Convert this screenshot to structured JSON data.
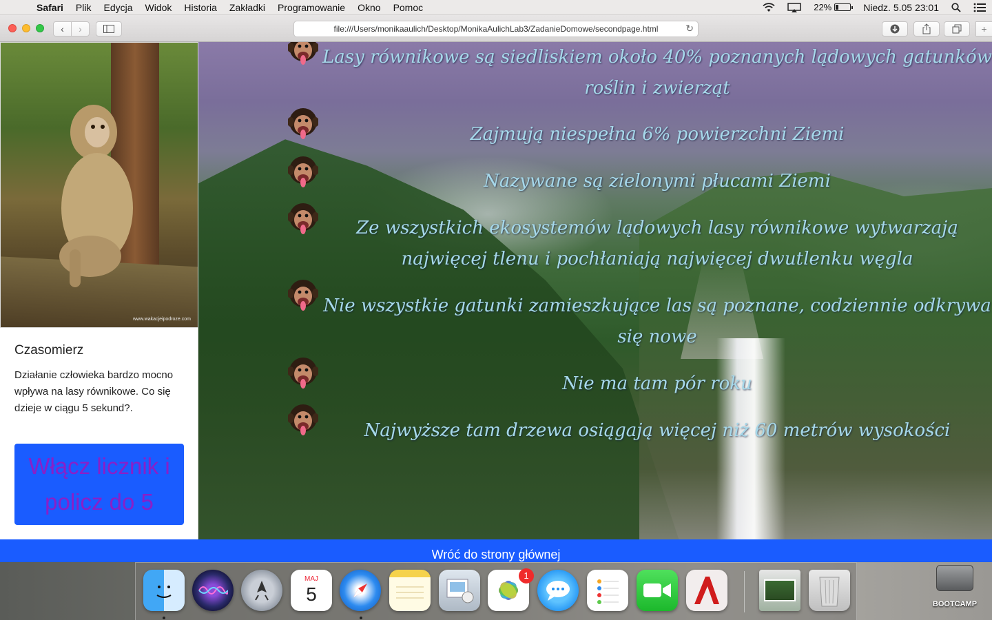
{
  "menubar": {
    "app_name": "Safari",
    "items": [
      "Plik",
      "Edycja",
      "Widok",
      "Historia",
      "Zakładki",
      "Programowanie",
      "Okno",
      "Pomoc"
    ],
    "battery_percent": "22%",
    "battery_level": 0.22,
    "datetime": "Niedz. 5.05  23:01"
  },
  "browser": {
    "url": "file:///Users/monikaaulich/Desktop/MonikaAulichLab3/ZadanieDomowe/secondpage.html"
  },
  "sidebar": {
    "photo_credit": "www.wakacjeipodroze.com",
    "timer": {
      "title": "Czasomierz",
      "description": "Działanie człowieka bardzo mocno wpływa na lasy równikowe. Co się dzieje w ciągu 5 sekund?.",
      "button_label": "Włącz licznik i policz do 5"
    }
  },
  "facts": [
    "Lasy równikowe są siedliskiem około 40% poznanych lądowych gatunków roślin i zwierząt",
    "Zajmują niespełna 6% powierzchni Ziemi",
    "Nazywane są zielonymi płucami Ziemi",
    "Ze wszystkich ekosystemów lądowych lasy równikowe wytwarzają najwięcej tlenu i pochłaniają najwięcej dwutlenku węgla",
    "Nie wszystkie gatunki zamieszkujące las są poznane, codziennie odkrywa się nowe",
    "Nie ma tam pór roku",
    "Najwyższe tam drzewa osiągają więcej niż 60 metrów wysokości"
  ],
  "footer": {
    "home_link": "Wróć do strony głównej"
  },
  "dock": {
    "calendar_month": "MAJ",
    "calendar_day": "5",
    "photos_badge": "1",
    "bootcamp_label": "BOOTCAMP"
  },
  "colors": {
    "accent_blue": "#1a5cff",
    "button_text_purple": "#8a1fc8",
    "fact_text": "#a6d8ea"
  }
}
